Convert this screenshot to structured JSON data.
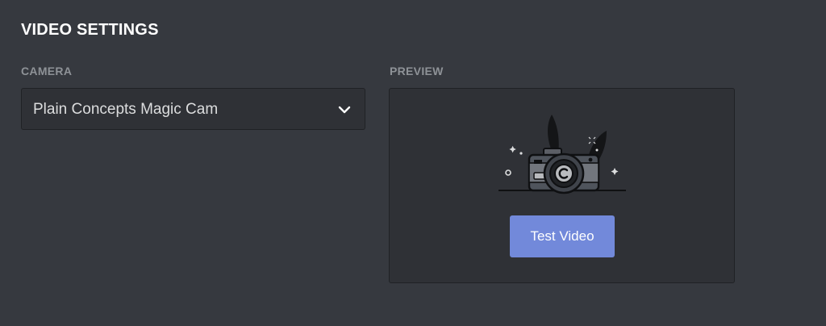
{
  "section": {
    "title": "VIDEO SETTINGS"
  },
  "camera": {
    "label": "CAMERA",
    "selected_value": "Plain Concepts Magic Cam",
    "icon": "chevron-down-icon"
  },
  "preview": {
    "label": "PREVIEW",
    "illustration": "camera-illustration",
    "test_button_label": "Test Video"
  },
  "colors": {
    "background": "#36393f",
    "panel": "#2f3136",
    "border": "#202225",
    "accent": "#7289da",
    "label": "#8e9297",
    "text": "#dcddde"
  }
}
